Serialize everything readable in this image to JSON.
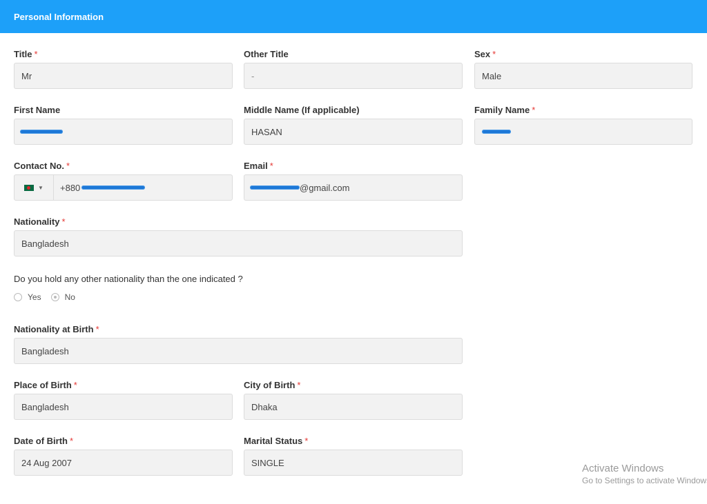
{
  "header": {
    "title": "Personal Information"
  },
  "fields": {
    "title": {
      "label": "Title",
      "value": "Mr"
    },
    "other_title": {
      "label": "Other Title",
      "value": "-"
    },
    "sex": {
      "label": "Sex",
      "value": "Male"
    },
    "first_name": {
      "label": "First Name",
      "value": ""
    },
    "middle_name": {
      "label": "Middle Name (If applicable)",
      "value": "HASAN"
    },
    "family_name": {
      "label": "Family Name",
      "value": ""
    },
    "contact": {
      "label": "Contact No.",
      "prefix": "+880"
    },
    "email": {
      "label": "Email",
      "suffix": "@gmail.com"
    },
    "nationality": {
      "label": "Nationality",
      "value": "Bangladesh"
    },
    "nationality_birth": {
      "label": "Nationality at Birth",
      "value": "Bangladesh"
    },
    "place_birth": {
      "label": "Place of Birth",
      "value": "Bangladesh"
    },
    "city_birth": {
      "label": "City of Birth",
      "value": "Dhaka"
    },
    "dob": {
      "label": "Date of Birth",
      "value": "24 Aug 2007"
    },
    "marital": {
      "label": "Marital Status",
      "value": "SINGLE"
    }
  },
  "required_marker": "*",
  "other_nationality": {
    "question": "Do you hold any other nationality than the one indicated ?",
    "options": [
      "Yes",
      "No"
    ],
    "selected": "No"
  },
  "watermark": {
    "title": "Activate Windows",
    "subtitle": "Go to Settings to activate Windows."
  },
  "colors": {
    "header": "#1da0f9",
    "required": "#e53935",
    "field_bg": "#f2f2f2"
  }
}
